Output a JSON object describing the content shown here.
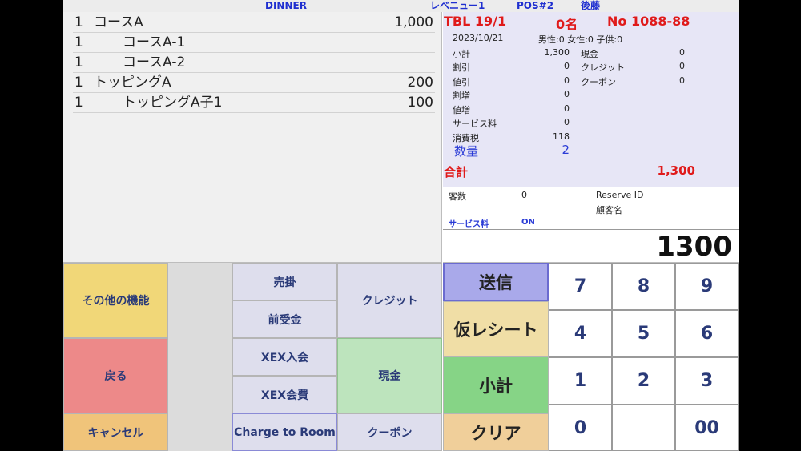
{
  "header": {
    "mode": "DINNER",
    "revenue": "レベニュー1",
    "pos": "POS#2",
    "user": "後藤"
  },
  "orders": [
    {
      "qty": "1",
      "name": "コースA",
      "price": "1,000",
      "indent": false
    },
    {
      "qty": "1",
      "name": "コースA-1",
      "price": "",
      "indent": true
    },
    {
      "qty": "1",
      "name": "コースA-2",
      "price": "",
      "indent": true
    },
    {
      "qty": "1",
      "name": "トッピングA",
      "price": "200",
      "indent": false
    },
    {
      "qty": "1",
      "name": "トッピングA子1",
      "price": "100",
      "indent": true
    }
  ],
  "summary": {
    "table": "TBL 19/1",
    "guests": "0名",
    "order_no": "No 1088-88",
    "date": "2023/10/21",
    "demographics": "男性:0 女性:0 子供:0",
    "left": [
      {
        "label": "小計",
        "value": "1,300"
      },
      {
        "label": "割引",
        "value": "0"
      },
      {
        "label": "値引",
        "value": "0"
      },
      {
        "label": "割増",
        "value": "0"
      },
      {
        "label": "値増",
        "value": "0"
      },
      {
        "label": "サービス料",
        "value": "0"
      },
      {
        "label": "消費税",
        "value": "118"
      }
    ],
    "right": [
      {
        "label": "現金",
        "value": "0"
      },
      {
        "label": "クレジット",
        "value": "0"
      },
      {
        "label": "クーポン",
        "value": "0"
      }
    ],
    "qty_label": "数量",
    "qty_value": "2",
    "total_label": "合計",
    "total_value": "1,300"
  },
  "info": {
    "guest_count_label": "客数",
    "guest_count_value": "0",
    "reserve_label": "Reserve ID",
    "customer_label": "顧客名",
    "service_label": "サービス料",
    "service_value": "ON"
  },
  "display_value": "1300",
  "buttons": {
    "other": "その他の機能",
    "back": "戻る",
    "cancel": "キャンセル",
    "urikake": "売掛",
    "maeuke": "前受金",
    "xex_join": "XEX入会",
    "xex_fee": "XEX会費",
    "charge_room": "Charge to Room",
    "credit": "クレジット",
    "cash": "現金",
    "coupon": "クーポン",
    "send": "送信",
    "temp_receipt": "仮レシート",
    "subtotal": "小計",
    "clear": "クリア"
  },
  "keypad": [
    "7",
    "8",
    "9",
    "4",
    "5",
    "6",
    "1",
    "2",
    "3",
    "0",
    "",
    "00"
  ]
}
